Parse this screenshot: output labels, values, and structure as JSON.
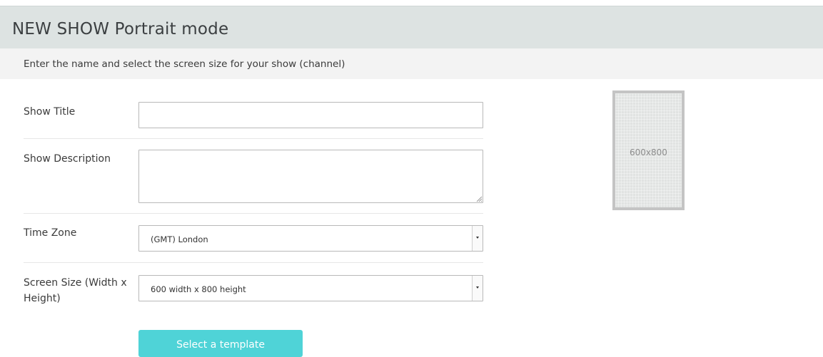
{
  "page": {
    "title": "NEW SHOW Portrait mode",
    "subtitle": "Enter the name and select the screen size for your show (channel)"
  },
  "form": {
    "show_title": {
      "label": "Show Title",
      "value": "",
      "placeholder": ""
    },
    "show_description": {
      "label": "Show Description",
      "value": "",
      "placeholder": ""
    },
    "time_zone": {
      "label": "Time Zone",
      "selected": "(GMT) London"
    },
    "screen_size": {
      "label": "Screen Size (Width x Height)",
      "selected": "600 width x 800 height"
    },
    "submit_label": "Select a template"
  },
  "preview": {
    "size_label": "600x800"
  },
  "colors": {
    "title_bar": "#dde3e2",
    "sub_bar": "#f3f3f3",
    "accent_button": "#4fd3d7",
    "preview_fill": "#e1e3e2",
    "preview_border": "#c4c4c4"
  },
  "icons": {
    "select_arrow": "caret-down-icon",
    "textarea_grip": "resize-grip-icon"
  }
}
